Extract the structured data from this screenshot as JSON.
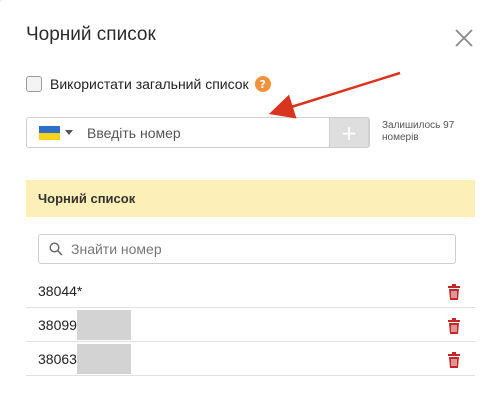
{
  "dialog": {
    "title": "Чорний список",
    "use_common_list_label": "Використати загальний список",
    "help_symbol": "?"
  },
  "phone_input": {
    "country": "Ukraine",
    "placeholder": "Введіть номер",
    "add_label": "+"
  },
  "remaining_text": "Залишилось 97 номерів",
  "blacklist": {
    "header": "Чорний список",
    "search_placeholder": "Знайти номер",
    "items": [
      {
        "number": "38044*",
        "masked": false
      },
      {
        "number": "38099",
        "masked": true
      },
      {
        "number": "38063",
        "masked": true
      }
    ]
  },
  "colors": {
    "header_bg": "#fcefb7",
    "help_icon": "#f0913b",
    "trash_icon": "#c0282b",
    "arrow": "#d8341f",
    "flag_blue": "#2f6fc4",
    "flag_yellow": "#f6d21c"
  }
}
